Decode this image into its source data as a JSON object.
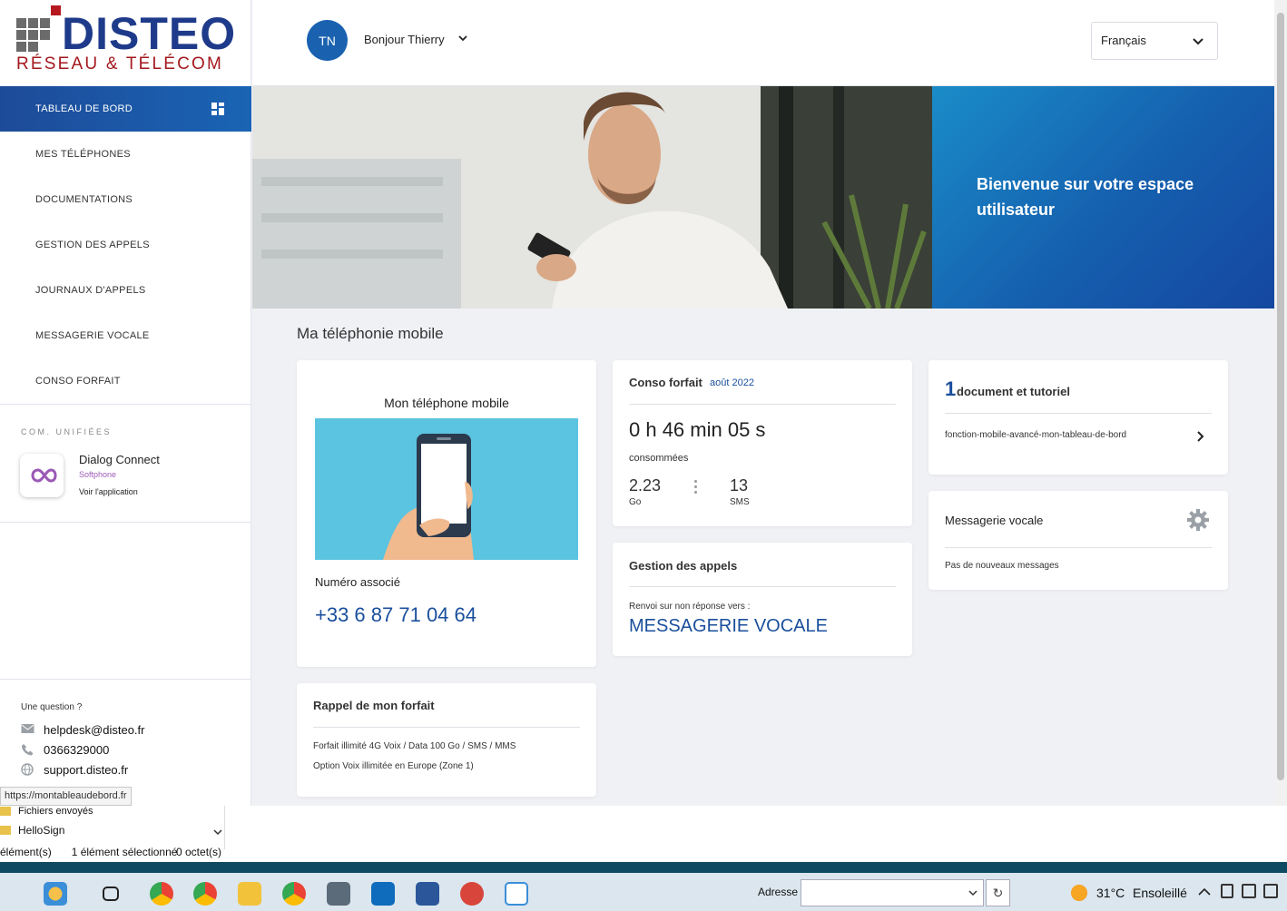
{
  "brand": {
    "name": "DISTEO",
    "tagline": "RÉSEAU & TÉLÉCOM"
  },
  "header": {
    "avatar_initials": "TN",
    "greeting": "Bonjour Thierry",
    "language": "Français"
  },
  "sidebar": {
    "items": [
      {
        "label": "TABLEAU DE BORD",
        "active": true
      },
      {
        "label": "MES TÉLÉPHONES"
      },
      {
        "label": "DOCUMENTATIONS"
      },
      {
        "label": "GESTION DES APPELS"
      },
      {
        "label": "JOURNAUX D'APPELS"
      },
      {
        "label": "MESSAGERIE VOCALE"
      },
      {
        "label": "CONSO FORFAIT"
      }
    ],
    "uc_title": "COM. UNIFIÉES",
    "uc_app": {
      "name": "Dialog Connect",
      "subtitle": "Softphone",
      "link": "Voir l'application"
    },
    "help": {
      "question": "Une question ?",
      "email": "helpdesk@disteo.fr",
      "phone": "0366329000",
      "website": "support.disteo.fr"
    },
    "status_url": "https://montableaudebord.fr"
  },
  "hero": {
    "welcome": "Bienvenue sur votre espace utilisateur"
  },
  "main": {
    "section_title": "Ma téléphonie mobile",
    "phone_card": {
      "title": "Mon téléphone mobile",
      "number_label": "Numéro associé",
      "number": "+33 6 87 71 04 64"
    },
    "conso_card": {
      "title": "Conso forfait",
      "period": "août 2022",
      "duration": "0 h 46 min 05 s",
      "duration_label": "consommées",
      "data_value": "2.23",
      "data_unit": "Go",
      "sms_value": "13",
      "sms_unit": "SMS"
    },
    "calls_card": {
      "title": "Gestion des appels",
      "label": "Renvoi sur non réponse vers :",
      "value": "MESSAGERIE VOCALE"
    },
    "docs_card": {
      "count": "1",
      "title": "document et tutoriel",
      "item": "fonction-mobile-avancé-mon-tableau-de-bord"
    },
    "voicemail_card": {
      "title": "Messagerie vocale",
      "status": "Pas de nouveaux messages"
    },
    "plan_card": {
      "title": "Rappel de mon forfait",
      "line1": "Forfait illimité 4G Voix / Data 100 Go / SMS / MMS",
      "line2": "Option Voix illimitée en Europe (Zone 1)"
    }
  },
  "explorer": {
    "items": [
      "Fichiers envoyés",
      "HelloSign"
    ],
    "status_count": "élément(s)",
    "status_selected": "1 élément sélectionné",
    "status_size": "0 octet(s)"
  },
  "taskbar": {
    "address_label": "Adresse",
    "weather_temp": "31°C",
    "weather_text": "Ensoleillé"
  }
}
